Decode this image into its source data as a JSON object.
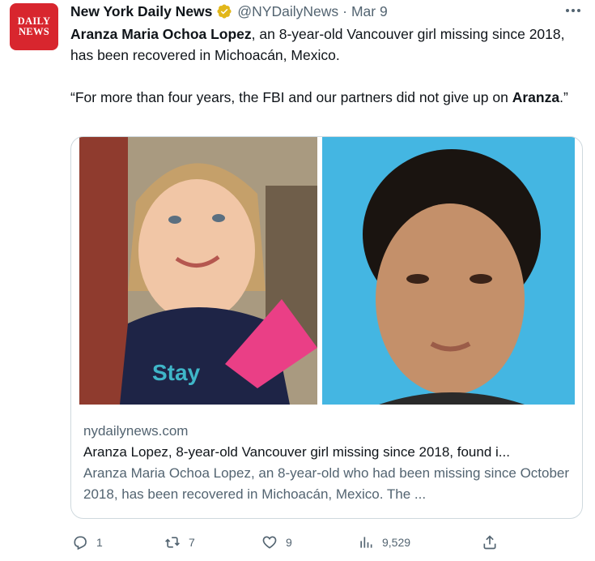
{
  "avatar": {
    "logo_line1": "DAILY",
    "logo_line2": "NEWS",
    "brand_color": "#d8262e"
  },
  "header": {
    "display_name": "New York Daily News",
    "handle": "@NYDailyNews",
    "separator": "·",
    "date": "Mar 9",
    "verified_icon": "verified-gold-badge",
    "verified_color": "#e2b719"
  },
  "tweet": {
    "line1_bold": "Aranza Maria Ochoa Lopez",
    "line1_rest": ", an 8-year-old Vancouver girl missing since 2018, has been recovered in Michoacán, Mexico.",
    "quote_prefix": "“For more than four years, the FBI and our partners did not give up on ",
    "quote_bold": "Aranza",
    "quote_suffix": ".”"
  },
  "card": {
    "domain": "nydailynews.com",
    "headline": "Aranza Lopez, 8-year-old Vancouver girl missing since 2018, found i...",
    "description": "Aranza Maria Ochoa Lopez, an 8-year-old who had been missing since October 2018, has been recovered in Michoacán, Mexico. The ...",
    "image_left_alt": "photo of smiling young girl",
    "image_right_alt": "photo of woman against blue background"
  },
  "actions": {
    "reply_count": "1",
    "retweet_count": "7",
    "like_count": "9",
    "views_count": "9,529",
    "icons": [
      "reply-icon",
      "retweet-icon",
      "like-icon",
      "views-icon",
      "share-icon"
    ]
  }
}
